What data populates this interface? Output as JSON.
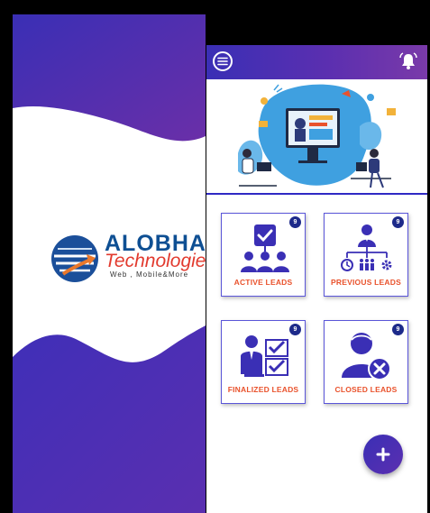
{
  "splash": {
    "logo": {
      "brand": "ALOBHA",
      "subtitle": "Technologies",
      "tagline": "Web , Mobile&More"
    }
  },
  "app": {
    "header": {
      "menu_icon": "menu-icon",
      "notification_icon": "bell-icon"
    },
    "cards": [
      {
        "label": "ACTIVE LEADS",
        "badge": "9",
        "icon": "checklist-team-icon"
      },
      {
        "label": "PREVIOUS LEADS",
        "badge": "9",
        "icon": "org-chart-icon"
      },
      {
        "label": "FINALIZED LEADS",
        "badge": "9",
        "icon": "person-checklist-icon"
      },
      {
        "label": "CLOSED LEADS",
        "badge": "9",
        "icon": "user-remove-icon"
      }
    ],
    "fab": {
      "icon": "plus-icon"
    },
    "colors": {
      "primary": "#3a2fb5",
      "accent": "#7a3aa9",
      "label": "#e9522c",
      "badge": "#1d2a8a"
    }
  }
}
